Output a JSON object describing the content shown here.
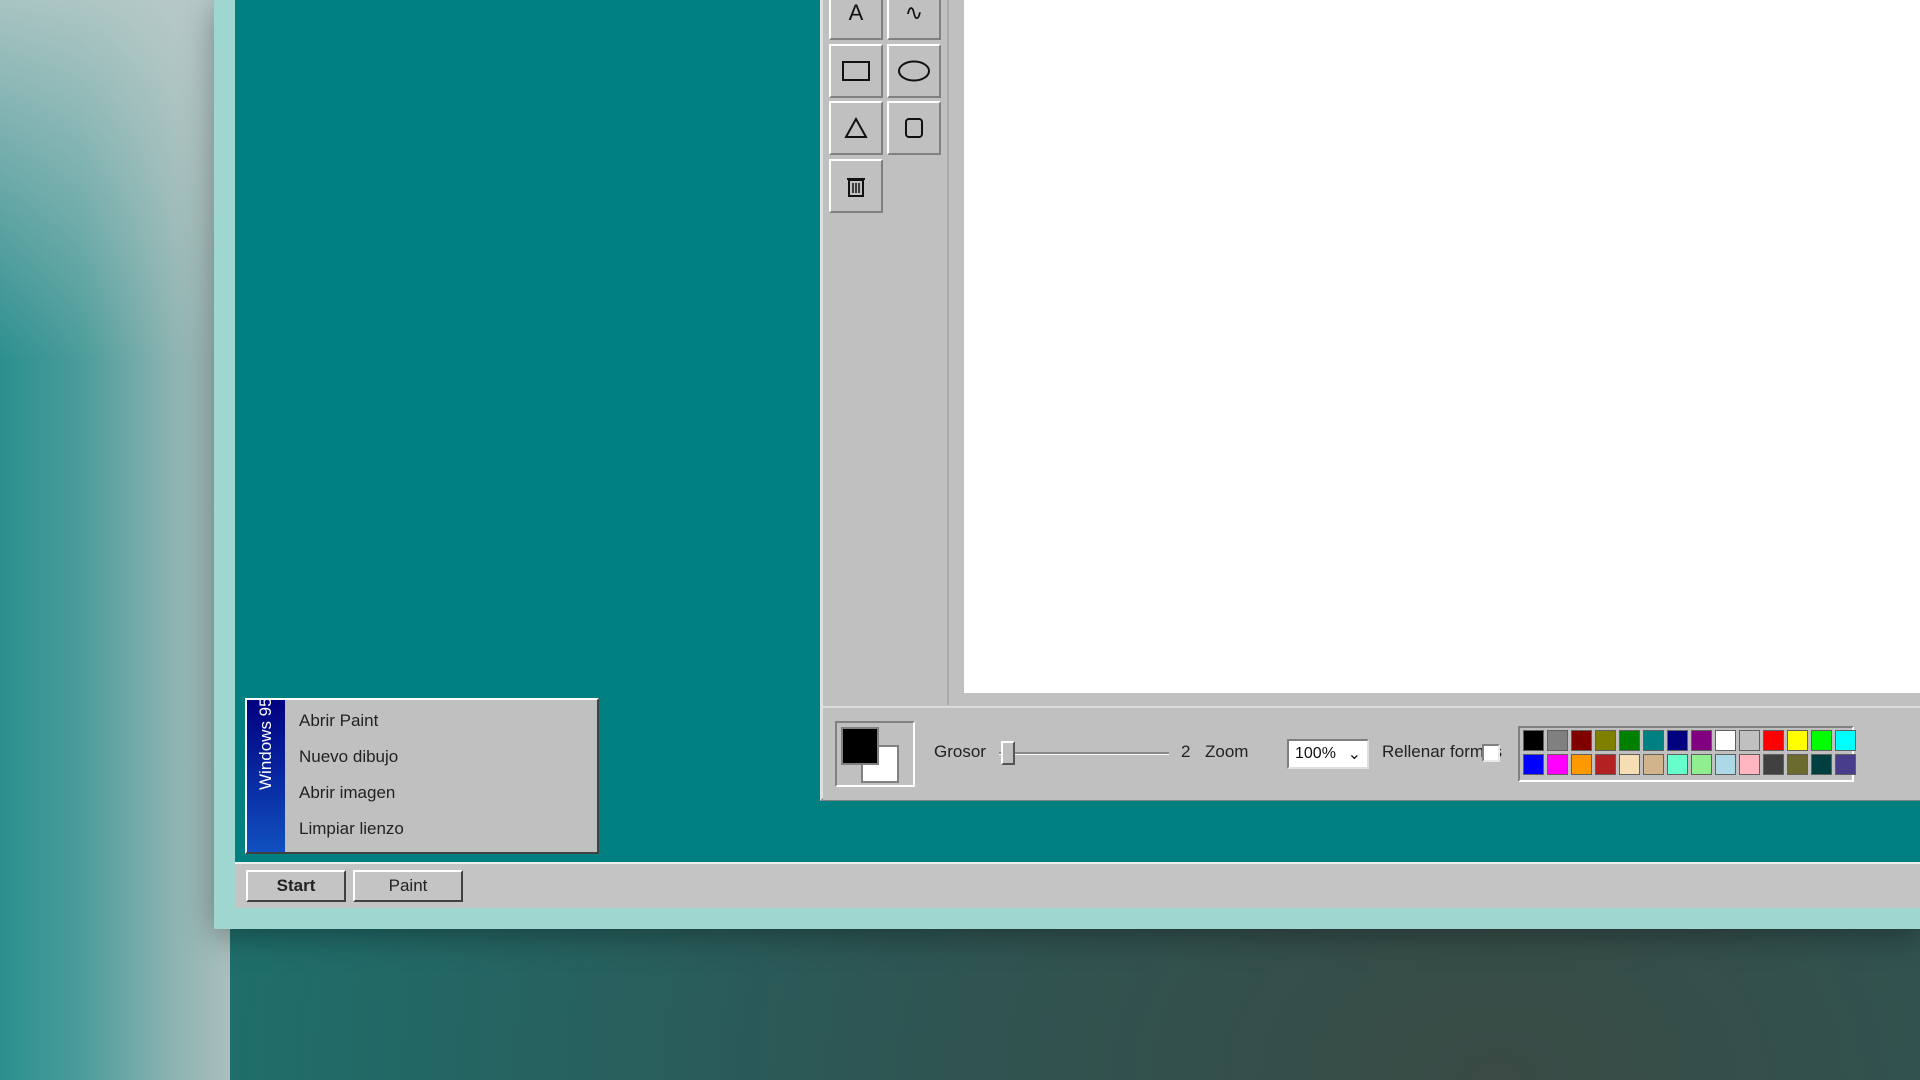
{
  "start_menu": {
    "banner": "Windows 95",
    "items": [
      {
        "label": "Abrir Paint"
      },
      {
        "label": "Nuevo dibujo"
      },
      {
        "label": "Abrir imagen"
      },
      {
        "label": "Limpiar lienzo"
      }
    ]
  },
  "taskbar": {
    "start_label": "Start",
    "paint_label": "Paint"
  },
  "paint": {
    "tools": {
      "text_icon": "A",
      "curve_icon": "∿"
    },
    "bottom_bar": {
      "thickness_label": "Grosor",
      "thickness_value": "2",
      "zoom_label": "Zoom",
      "zoom_value": "100%",
      "fill_label": "Rellenar formas",
      "primary_color": "#000000",
      "secondary_color": "#ffffff"
    },
    "palette": [
      "#000000",
      "#808080",
      "#800000",
      "#808000",
      "#008000",
      "#008080",
      "#000080",
      "#800080",
      "#ffffff",
      "#c0c0c0",
      "#ff0000",
      "#ffff00",
      "#00ff00",
      "#00ffff",
      "#0000ff",
      "#ff00ff",
      "#ff9900",
      "#b22222",
      "#f5deb3",
      "#d2b48c",
      "#66ffcc",
      "#90ee90",
      "#add8e6",
      "#ffb6c1",
      "#404040",
      "#6b6b2f",
      "#004040",
      "#483d8b"
    ]
  },
  "colors": {
    "desktop": "#008080",
    "face": "#c0c0c0"
  }
}
